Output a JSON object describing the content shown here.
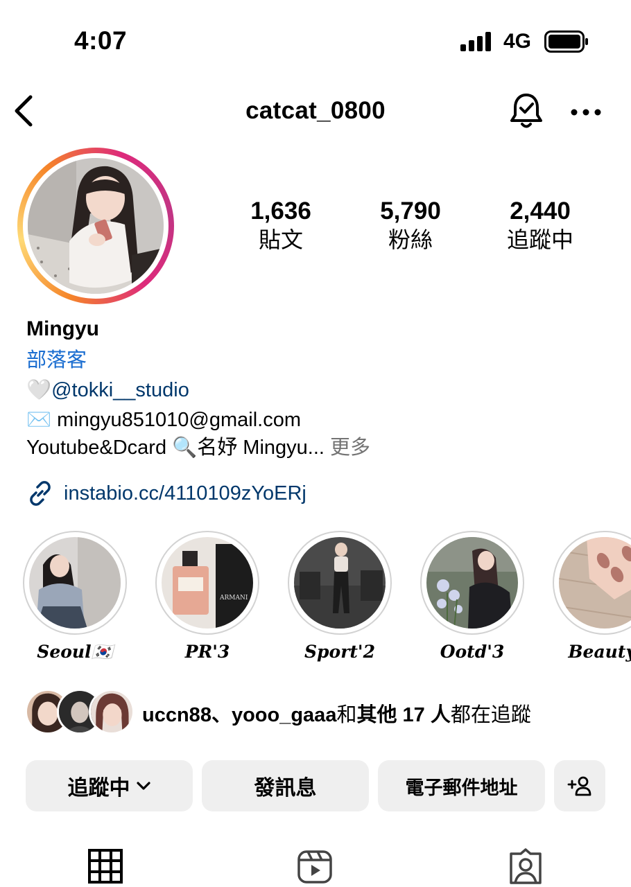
{
  "status_bar": {
    "time": "4:07",
    "network": "4G"
  },
  "header": {
    "username": "catcat_0800"
  },
  "stats": [
    {
      "value": "1,636",
      "label": "貼文"
    },
    {
      "value": "5,790",
      "label": "粉絲"
    },
    {
      "value": "2,440",
      "label": "追蹤中"
    }
  ],
  "bio": {
    "name": "Mingyu",
    "category": "部落客",
    "line1_emoji": "🤍",
    "line1_mention": "@tokki__studio",
    "line2_emoji": "✉️",
    "line2_text": "mingyu851010@gmail.com",
    "line3_text": "Youtube&Dcard 🔍名妤 Mingyu...",
    "line3_more": "更多",
    "link": "instabio.cc/4110109zYoERj"
  },
  "highlights": [
    {
      "label": "Seoul🇰🇷"
    },
    {
      "label": "PR'3"
    },
    {
      "label": "Sport'2"
    },
    {
      "label": "Ootd'3"
    },
    {
      "label": "Beauty'"
    }
  ],
  "followed_by": {
    "names": "uccn88、yooo_gaaa",
    "connector": "和",
    "others": "其他 17 人",
    "suffix": "都在追蹤"
  },
  "buttons": {
    "following": "追蹤中",
    "message": "發訊息",
    "email": "電子郵件地址"
  },
  "tabs": {
    "grid": "grid-icon",
    "reels": "reels-icon",
    "tagged": "tagged-icon"
  }
}
